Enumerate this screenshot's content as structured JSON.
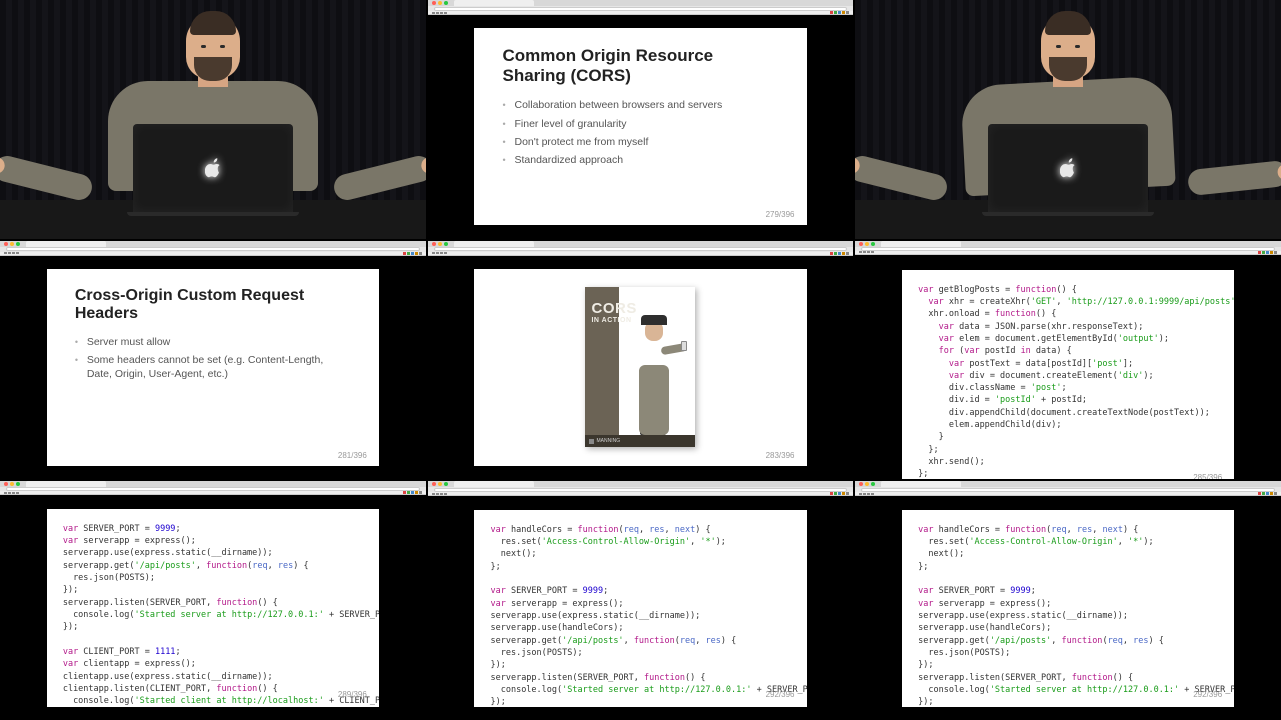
{
  "slide_cors": {
    "title": "Common Origin Resource Sharing (CORS)",
    "bullets": [
      "Collaboration between browsers and servers",
      "Finer level of granularity",
      "Don't protect me from myself",
      "Standardized approach"
    ],
    "page": "279/396"
  },
  "slide_headers": {
    "title": "Cross-Origin Custom Request Headers",
    "bullets": [
      "Server must allow",
      "Some headers cannot be set (e.g. Content-Length, Date, Origin, User-Agent, etc.)"
    ],
    "page": "281/396"
  },
  "book": {
    "title_line1": "CORS",
    "title_line2": "IN ACTION",
    "publisher": "MANNING",
    "page": "283/396"
  },
  "code_client": {
    "page": "285/396"
  },
  "code_server_basic": {
    "page": "289/396"
  },
  "code_server_cors": {
    "page": "292/396"
  },
  "code_server_cors2": {
    "page": "292/396"
  }
}
